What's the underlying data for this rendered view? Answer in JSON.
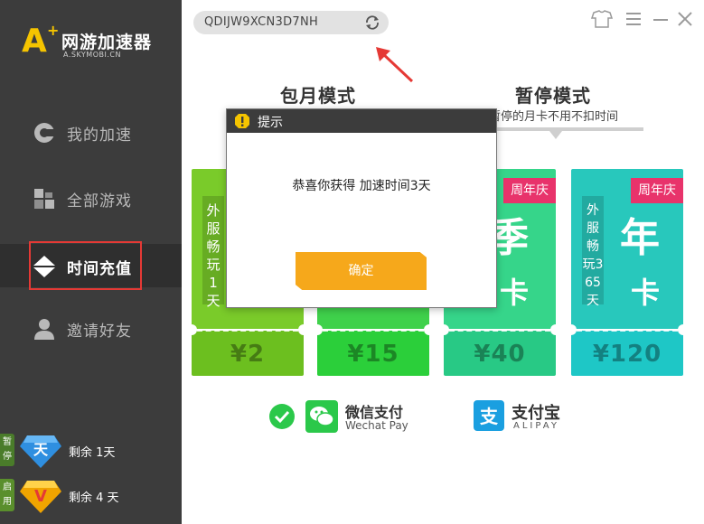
{
  "app": {
    "logo_letter": "A",
    "logo_plus": "+",
    "logo_name": "网游加速器",
    "logo_domain": "A.SKYMOBI.CN"
  },
  "sidebar": {
    "items": [
      {
        "label": "我的加速",
        "icon": "speed-icon"
      },
      {
        "label": "全部游戏",
        "icon": "games-icon"
      },
      {
        "label": "时间充值",
        "icon": "recharge-icon",
        "active": true
      },
      {
        "label": "邀请好友",
        "icon": "user-icon"
      }
    ],
    "status": [
      {
        "tag": "暂停",
        "gem_char": "天",
        "text": "剩余 1天"
      },
      {
        "tag": "启用",
        "gem_char": "V",
        "text": "剩余 4 天"
      }
    ]
  },
  "top": {
    "code": "QDIJW9XCN3D7NH"
  },
  "modes": {
    "monthly_title": "包月模式",
    "pause_title": "暂停模式",
    "pause_desc": "可暂停的月卡不用不扣时间"
  },
  "cards": [
    {
      "vertical_text": "外服畅玩1天",
      "big": "",
      "price": "¥2",
      "badge": ""
    },
    {
      "vertical_text": "",
      "big": "",
      "price": "¥15",
      "badge": ""
    },
    {
      "vertical_text": "",
      "big_top": "季",
      "big_bottom": "卡",
      "price": "¥40",
      "badge": "周年庆"
    },
    {
      "vertical_text": "外服畅玩365天",
      "big_top": "年",
      "big_bottom": "卡",
      "price": "¥120",
      "badge": "周年庆"
    }
  ],
  "payment": {
    "wechat_title": "微信支付",
    "wechat_sub": "Wechat Pay",
    "alipay_title": "支付宝",
    "alipay_sub": "ALIPAY"
  },
  "dialog": {
    "title": "提示",
    "message": "恭喜你获得 加速时间3天",
    "ok_label": "确定"
  },
  "colors": {
    "sidebar_bg": "#3c3c3c",
    "accent_yellow": "#f5c400",
    "dialog_button": "#f6a81b",
    "badge_pink": "#e8336b",
    "highlight_red": "#e53935"
  }
}
